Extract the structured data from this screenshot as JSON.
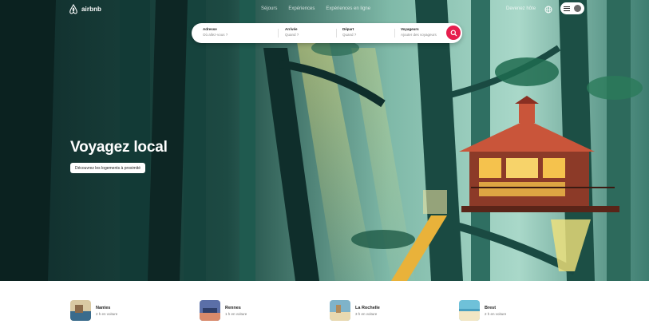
{
  "brand": {
    "name": "airbnb",
    "accent": "#e61e4d"
  },
  "nav": {
    "links": [
      "Séjours",
      "Expériences",
      "Expériences en ligne"
    ],
    "host_label": "Devenez hôte",
    "globe_icon": "globe-icon",
    "menu_icon": "hamburger-icon",
    "avatar_icon": "user-avatar-icon"
  },
  "search": {
    "location_label": "Adresse",
    "location_placeholder": "Où allez-vous ?",
    "checkin_label": "Arrivée",
    "checkin_placeholder": "Quand ?",
    "checkout_label": "Départ",
    "checkout_placeholder": "Quand ?",
    "guests_label": "Voyageurs",
    "guests_placeholder": "Ajouter des voyageurs",
    "button_icon": "search-icon"
  },
  "hero": {
    "headline": "Voyagez local",
    "cta": "Découvrez les logements à proximité"
  },
  "destinations": [
    {
      "name": "Nantes",
      "distance": "2 h en voiture",
      "colors": [
        "#d9c9a3",
        "#3a6b8c"
      ]
    },
    {
      "name": "Rennes",
      "distance": "1 h en voiture",
      "colors": [
        "#5b6fa8",
        "#d98a6b"
      ]
    },
    {
      "name": "La Rochelle",
      "distance": "3 h en voiture",
      "colors": [
        "#7fb3c9",
        "#e8d9b0"
      ]
    },
    {
      "name": "Brest",
      "distance": "2 h en voiture",
      "colors": [
        "#6fc1d9",
        "#f2e6c4"
      ]
    }
  ]
}
